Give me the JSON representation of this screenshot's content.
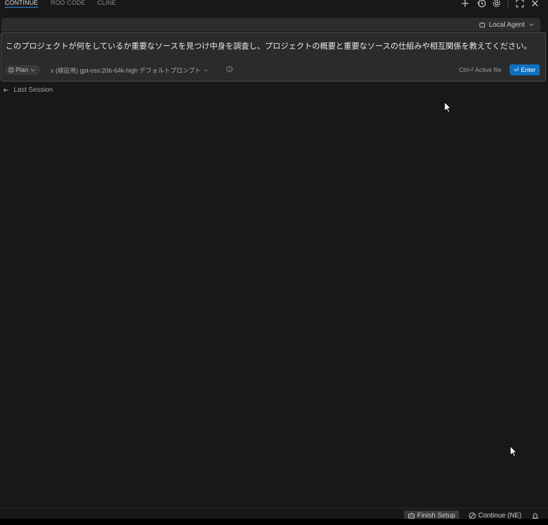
{
  "tabs": [
    {
      "label": "CONTINUE",
      "active": true
    },
    {
      "label": "ROO CODE",
      "active": false
    },
    {
      "label": "CLINE",
      "active": false
    }
  ],
  "toolbar_icons": [
    "plus-icon",
    "history-icon",
    "gear-icon",
    "expand-icon",
    "close-icon"
  ],
  "agent_selector": {
    "label": "Local Agent",
    "icon": "agent-icon"
  },
  "input": {
    "text": "このプロジェクトが何をしているか重要なソースを見つけ中身を調査し、プロジェクトの概要と重要なソースの仕組みや相互関係を教えてください。",
    "mode": "Plan",
    "model": "x (検証用) gpt-oss:20b-64k-high デフォルトプロンプト",
    "active_file_hint": "Ctrl⏎ Active file",
    "submit_label": "Enter"
  },
  "last_session": {
    "label": "Last Session"
  },
  "status_bar": {
    "finish_setup": "Finish Setup",
    "continue_status": "Continue (NE)"
  },
  "colors": {
    "background": "#181818",
    "panel": "#2b2b2b",
    "accent": "#0e70c0"
  }
}
